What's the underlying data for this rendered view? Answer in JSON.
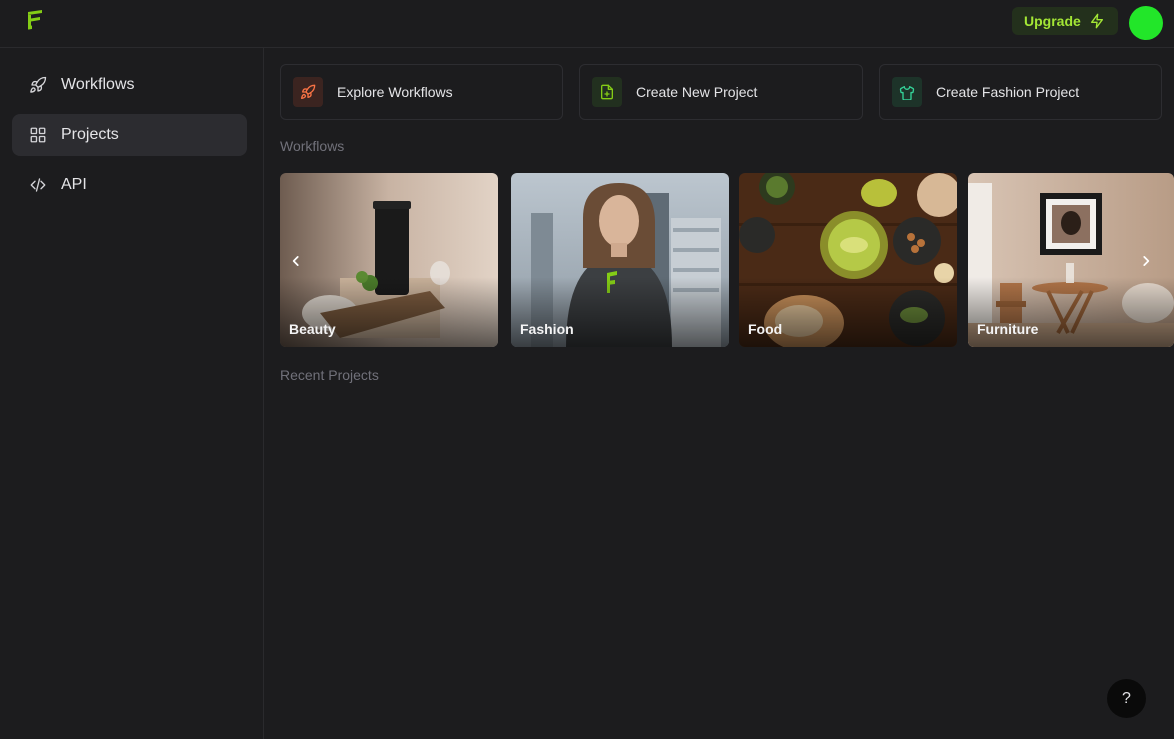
{
  "header": {
    "logo_icon": "brand-logo-icon",
    "upgrade_label": "Upgrade",
    "upgrade_icon": "lightning-icon",
    "avatar_color": "#22e629"
  },
  "sidebar": {
    "items": [
      {
        "label": "Workflows",
        "icon": "rocket-icon",
        "active": false
      },
      {
        "label": "Projects",
        "icon": "grid-icon",
        "active": true
      },
      {
        "label": "API",
        "icon": "code-icon",
        "active": false
      }
    ]
  },
  "actions": [
    {
      "label": "Explore Workflows",
      "icon": "rocket-icon",
      "icon_bg": "#3b2420",
      "icon_color": "#f97345"
    },
    {
      "label": "Create New Project",
      "icon": "file-plus-icon",
      "icon_bg": "#22301f",
      "icon_color": "#84cc16"
    },
    {
      "label": "Create Fashion Project",
      "icon": "shirt-icon",
      "icon_bg": "#1d3329",
      "icon_color": "#34d399"
    }
  ],
  "workflows_section": {
    "title": "Workflows",
    "tiles": [
      {
        "label": "Beauty"
      },
      {
        "label": "Fashion"
      },
      {
        "label": "Food"
      },
      {
        "label": "Furniture"
      }
    ],
    "prev_icon": "chevron-left-icon",
    "next_icon": "chevron-right-icon"
  },
  "recent_section": {
    "title": "Recent Projects"
  },
  "help": {
    "label": "?"
  },
  "colors": {
    "background": "#1c1c1e",
    "accent": "#a3e635",
    "upgrade_bg": "#23301c"
  }
}
